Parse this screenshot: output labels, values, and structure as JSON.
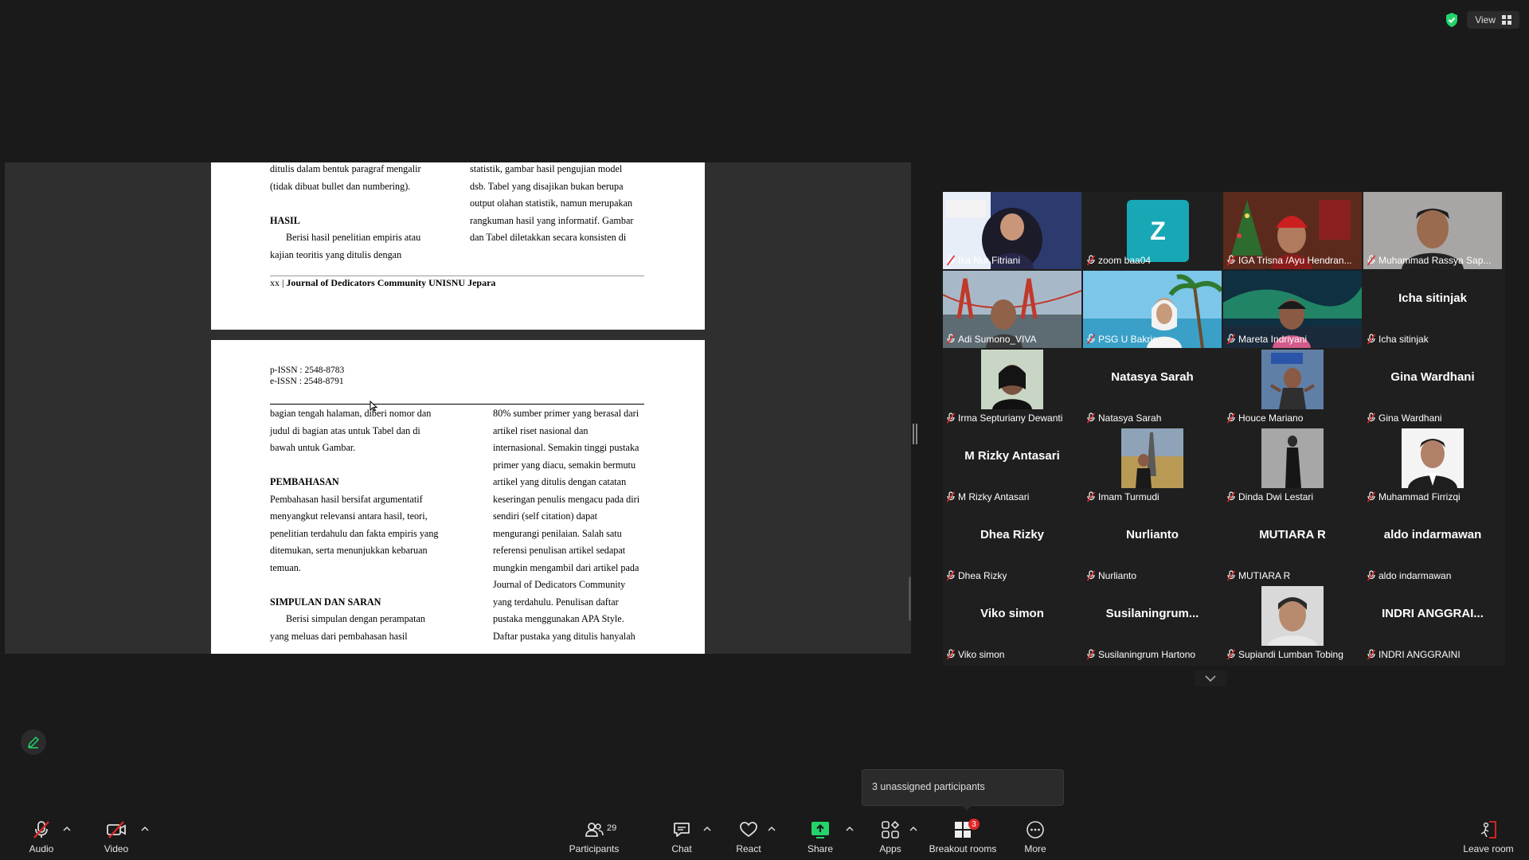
{
  "top_bar": {
    "view_label": "View"
  },
  "document": {
    "page1": {
      "left_col": [
        "ditulis dalam bentuk paragraf mengalir",
        "(tidak dibuat bullet dan numbering).",
        "",
        "HASIL",
        "Berisi hasil penelitian empiris atau",
        "kajian teoritis yang ditulis dengan"
      ],
      "right_col": [
        "statistik, gambar hasil pengujian model",
        "dsb. Tabel yang disajikan bukan berupa",
        "output olahan statistik, namun merupakan",
        "rangkuman hasil yang informatif. Gambar",
        "dan Tabel diletakkan secara konsisten di"
      ],
      "footer_prefix": "xx | ",
      "footer_journal": "Journal of Dedicators Community UNISNU Jepara"
    },
    "page2": {
      "issn_print": "p-ISSN : 2548-8783",
      "issn_online": "e-ISSN : 2548-8791",
      "left_col": [
        "bagian tengah halaman, diberi nomor dan",
        "judul di bagian atas untuk Tabel dan di",
        "bawah untuk Gambar.",
        "",
        "PEMBAHASAN",
        "Pembahasan hasil bersifat argumentatif",
        "menyangkut relevansi antara hasil, teori,",
        "penelitian terdahulu dan fakta empiris yang",
        "ditemukan, serta menunjukkan kebaruan",
        "temuan.",
        "",
        "SIMPULAN DAN SARAN",
        "Berisi simpulan dengan perampatan",
        "yang meluas dari pembahasan hasil"
      ],
      "right_col": [
        "80% sumber primer yang berasal dari",
        "artikel riset nasional dan",
        "internasional. Semakin tinggi pustaka",
        "primer yang diacu, semakin bermutu",
        "artikel yang ditulis dengan catatan",
        "keseringan penulis mengacu pada diri",
        "sendiri (self citation) dapat",
        "mengurangi penilaian. Salah satu",
        "referensi penulisan artikel sedapat",
        "mungkin mengambil dari artikel pada",
        "Journal of Dedicators Community",
        "yang terdahulu. Penulisan daftar",
        "pustaka menggunakan APA Style.",
        "Daftar pustaka yang ditulis hanyalah"
      ]
    }
  },
  "participants": [
    {
      "name": "Ika Nur Fitriani",
      "big": "",
      "video": "ika"
    },
    {
      "name": "zoom baa04",
      "big": "",
      "video": "z",
      "avatar_letter": "Z"
    },
    {
      "name": "IGA Trisna /Ayu Hendran...",
      "big": "",
      "video": "iga"
    },
    {
      "name": "Muhammad Rassya Sap...",
      "big": "",
      "video": "rassya"
    },
    {
      "name": "Adi Sumono_VIVA",
      "big": "",
      "video": "adi"
    },
    {
      "name": "PSG U Bakrie",
      "big": "",
      "video": "psg",
      "active": true
    },
    {
      "name": "Mareta Indriyani",
      "big": "",
      "video": "mareta"
    },
    {
      "name": "Icha sitinjak",
      "big": "Icha sitinjak",
      "video": ""
    },
    {
      "name": "Irma Septuriany Dewanti",
      "big": "",
      "video": "irma"
    },
    {
      "name": "Natasya Sarah",
      "big": "Natasya Sarah",
      "video": ""
    },
    {
      "name": "Houce Mariano",
      "big": "",
      "video": "houce"
    },
    {
      "name": "Gina Wardhani",
      "big": "Gina Wardhani",
      "video": ""
    },
    {
      "name": "M Rizky Antasari",
      "big": "M Rizky Antasari",
      "video": ""
    },
    {
      "name": "Imam Turmudi",
      "big": "",
      "video": "imam"
    },
    {
      "name": "Dinda Dwi Lestari",
      "big": "",
      "video": "dinda"
    },
    {
      "name": "Muhammad Firrizqi",
      "big": "",
      "video": "firrizqi"
    },
    {
      "name": "Dhea Rizky",
      "big": "Dhea Rizky",
      "video": ""
    },
    {
      "name": "Nurlianto",
      "big": "Nurlianto",
      "video": ""
    },
    {
      "name": "MUTIARA R",
      "big": "MUTIARA R",
      "video": ""
    },
    {
      "name": "aldo indarmawan",
      "big": "aldo indarmawan",
      "video": ""
    },
    {
      "name": "Viko simon",
      "big": "Viko simon",
      "video": ""
    },
    {
      "name": "Susilaningrum Hartono",
      "big": "Susilaningrum...",
      "video": ""
    },
    {
      "name": "Supiandi Lumban Tobing",
      "big": "",
      "video": "supiandi"
    },
    {
      "name": "INDRI ANGGRAINI",
      "big": "INDRI ANGGRAI...",
      "video": ""
    }
  ],
  "tooltip": {
    "text": "3 unassigned participants"
  },
  "toolbar": {
    "audio": "Audio",
    "video": "Video",
    "participants": "Participants",
    "participants_count": "29",
    "chat": "Chat",
    "react": "React",
    "share": "Share",
    "apps": "Apps",
    "breakout": "Breakout rooms",
    "breakout_badge": "3",
    "more": "More",
    "leave": "Leave room"
  },
  "colors": {
    "share_green": "#24d46b",
    "mute_red": "#e02828",
    "avatar_teal": "#18a7b5"
  }
}
